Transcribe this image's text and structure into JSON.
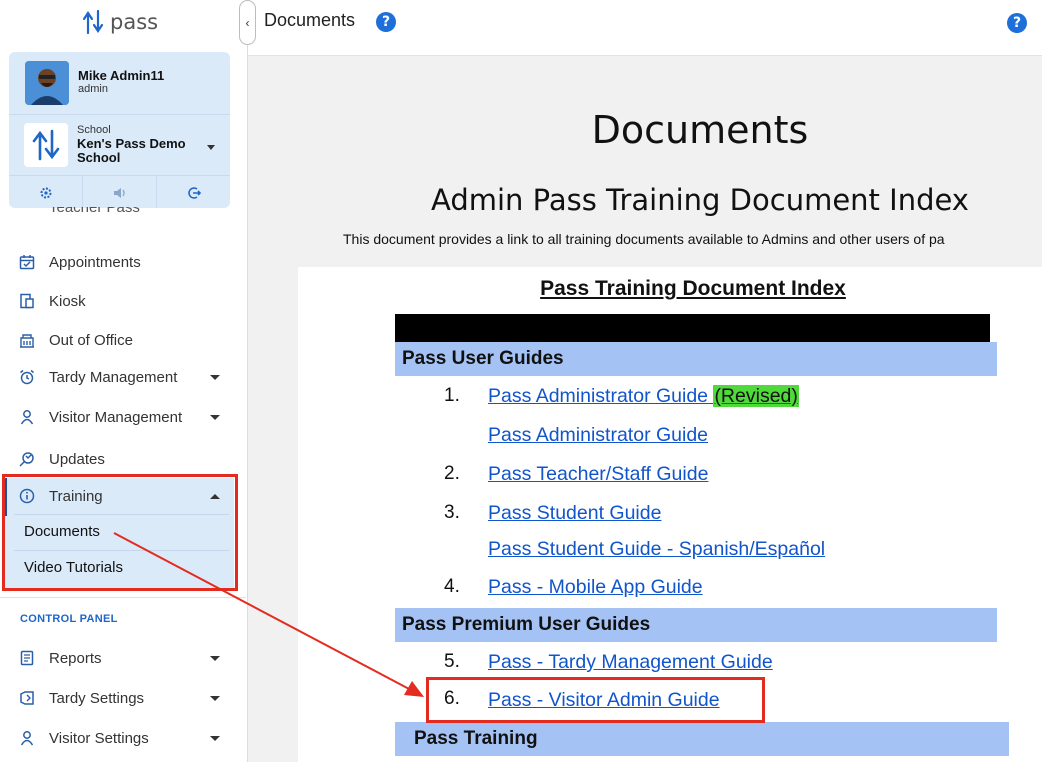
{
  "app": {
    "logo_text": "pass"
  },
  "user": {
    "name": "Mike Admin11",
    "role": "admin"
  },
  "school": {
    "label": "School",
    "name": "Ken's Pass Demo School"
  },
  "sidebar": {
    "partial_item": "Teacher Pass",
    "items": [
      {
        "label": "Appointments",
        "icon": "calendar-icon"
      },
      {
        "label": "Kiosk",
        "icon": "kiosk-icon"
      },
      {
        "label": "Out of Office",
        "icon": "building-icon"
      },
      {
        "label": "Tardy Management",
        "icon": "alarm-clock-icon"
      },
      {
        "label": "Visitor Management",
        "icon": "person-icon"
      },
      {
        "label": "Updates",
        "icon": "updates-icon"
      },
      {
        "label": "Training",
        "icon": "info-icon"
      }
    ],
    "training_sub": [
      "Documents",
      "Video Tutorials"
    ],
    "control_panel_label": "CONTROL PANEL",
    "control_items": [
      {
        "label": "Reports",
        "icon": "report-icon"
      },
      {
        "label": "Tardy Settings",
        "icon": "tag-icon"
      },
      {
        "label": "Visitor Settings",
        "icon": "person-icon"
      }
    ]
  },
  "header": {
    "title": "Documents",
    "help": "?"
  },
  "main": {
    "title": "Documents",
    "index_title": "Admin Pass Training Document Index",
    "description": "This document provides a link to all training documents available to Admins and other users of pa"
  },
  "document": {
    "heading": "Pass Training Document Index",
    "sections": [
      "Pass User Guides",
      "Pass Premium User Guides",
      "Pass Training"
    ],
    "rows": [
      {
        "num": "1.",
        "link": "Pass Administrator Guide",
        "badge": "(Revised)"
      },
      {
        "num": "",
        "link": "Pass Administrator Guide"
      },
      {
        "num": "2.",
        "link": "Pass Teacher/Staff Guide"
      },
      {
        "num": "3.",
        "link": "Pass Student Guide"
      },
      {
        "num": "",
        "link": "Pass Student Guide - Spanish/Español"
      },
      {
        "num": "4.",
        "link": "Pass - Mobile App Guide"
      },
      {
        "num": "5.",
        "link": "Pass - Tardy Management Guide"
      },
      {
        "num": "6.",
        "link": "Pass - Visitor Admin Guide"
      }
    ]
  },
  "colors": {
    "accent": "#1e66c8",
    "highlight": "#e32b20",
    "section_bg": "#a4c2f4",
    "badge_bg": "#4fd93a"
  }
}
